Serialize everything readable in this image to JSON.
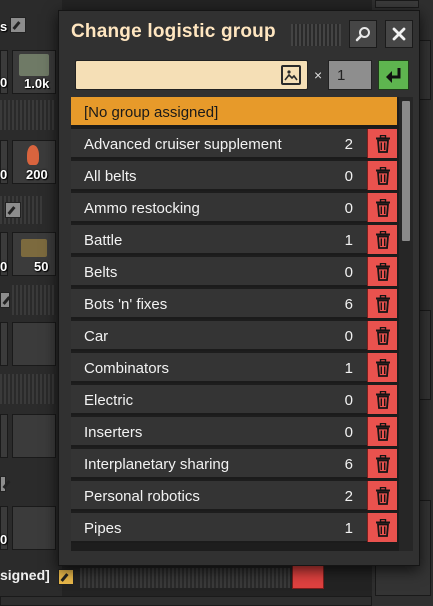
{
  "dialog": {
    "title": "Change logistic group",
    "search": {
      "value": "",
      "placeholder": ""
    },
    "multiplier_symbol": "×",
    "count_value": "1",
    "groups": [
      {
        "name": "[No group assigned]",
        "count": "",
        "selected": true
      },
      {
        "name": "Advanced cruiser supplement",
        "count": "2"
      },
      {
        "name": "All belts",
        "count": "0"
      },
      {
        "name": "Ammo restocking",
        "count": "0"
      },
      {
        "name": "Battle",
        "count": "1"
      },
      {
        "name": "Belts",
        "count": "0"
      },
      {
        "name": "Bots 'n' fixes",
        "count": "6"
      },
      {
        "name": "Car",
        "count": "0"
      },
      {
        "name": "Combinators",
        "count": "1"
      },
      {
        "name": "Electric",
        "count": "0"
      },
      {
        "name": "Inserters",
        "count": "0"
      },
      {
        "name": "Interplanetary sharing",
        "count": "6"
      },
      {
        "name": "Personal robotics",
        "count": "2"
      },
      {
        "name": "Pipes",
        "count": "1"
      }
    ]
  },
  "background": {
    "fragment_s": "s",
    "stack_1k": "1.0k",
    "stack_200": "200",
    "stack_50": "50",
    "left_zero_a": "0",
    "left_zero_b": "0",
    "left_zero_c": "0",
    "left_zero_d": "0",
    "group_label_fragment": "signed]"
  },
  "colors": {
    "accent_selected": "#e79a2a",
    "delete_red": "#e9524e",
    "confirm_green": "#5eb54f",
    "title_text": "#ffe6c0"
  }
}
